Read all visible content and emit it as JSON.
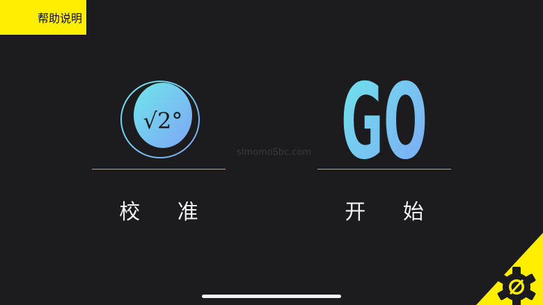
{
  "help": {
    "label": "帮助说明"
  },
  "calibrate": {
    "label": "校 准",
    "icon_text": "√2°",
    "icon": "sqrt-degree-circle-icon"
  },
  "start": {
    "label": "开 始",
    "icon_text": "GO",
    "icon": "go-text-icon"
  },
  "watermark": {
    "text": "slmomoSbc.com"
  },
  "settings": {
    "icon": "gear-icon"
  },
  "colors": {
    "background": "#1c1c1e",
    "accent_yellow": "#ffee00",
    "gradient_cyan": "#6fe3ea",
    "gradient_blue": "#7aa8f5",
    "label": "#f2f2f2"
  }
}
